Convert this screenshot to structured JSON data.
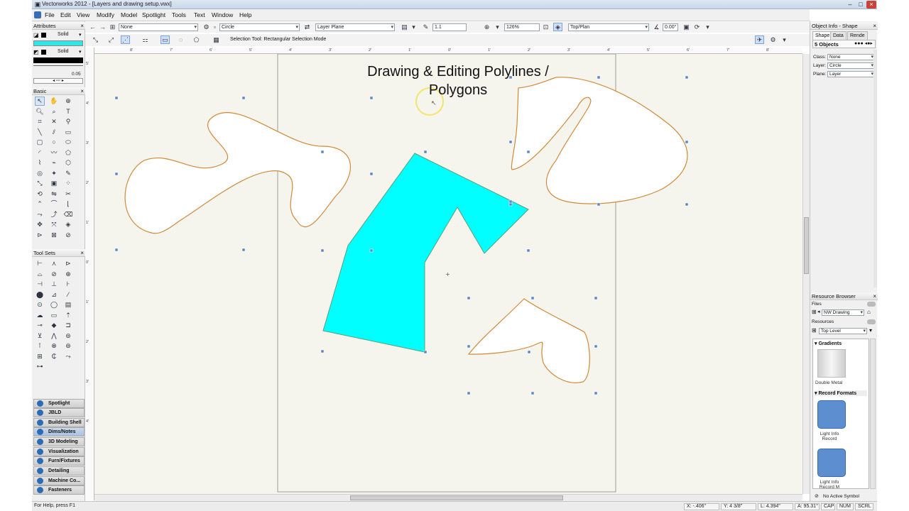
{
  "window": {
    "title": "Vectorworks 2012 - [Layers and drawing setup.vwx]"
  },
  "menu": [
    "File",
    "Edit",
    "View",
    "Modify",
    "Model",
    "Spotlight",
    "Tools",
    "Text",
    "Window",
    "Help"
  ],
  "view_bar": {
    "class_value": "None",
    "fill_value": "Circle",
    "layer_value": "Layer Plane",
    "pen_value": "1.1",
    "zoom_value": "126%",
    "view_value": "Top/Plan",
    "angle_value": "0.00°"
  },
  "mode_bar": {
    "mode_text": "Selection Tool: Rectangular Selection Mode"
  },
  "attributes": {
    "title": "Attributes",
    "fill_label": "Solid",
    "pen_label": "Solid",
    "fill_color": "#33e6e6",
    "line_value": "0.05"
  },
  "basic": {
    "title": "Basic"
  },
  "toolsets": {
    "title": "Tool Sets"
  },
  "workspace_bars": [
    "Spotlight",
    "JBLD",
    "Building Shell",
    "Dims/Notes",
    "3D Modeling",
    "Visualization",
    "Furn/Fixtures",
    "Detailing",
    "Machine Co...",
    "Fasteners"
  ],
  "rulers": {
    "top": [
      "8'",
      "7'",
      "6'",
      "5'",
      "4'",
      "3'",
      "2'",
      "1'",
      "0'",
      "1'",
      "2'",
      "3'",
      "4'",
      "5'",
      "6'",
      "7'",
      "8'"
    ],
    "left": [
      "5'",
      "4'",
      "3'",
      "2'",
      "1'",
      "0'",
      "1'",
      "2'",
      "3'",
      "4'"
    ]
  },
  "canvas": {
    "heading_line1": "Drawing & Editing Polylines /",
    "heading_line2": "Polygons",
    "colors": {
      "stroke": "#d08a3a",
      "poly_fill": "#00ffff",
      "shape_fill": "#ffffff",
      "handle": "#5a86c7",
      "highlight": "#f2e66a"
    }
  },
  "object_info": {
    "title": "Object Info - Shape",
    "tabs": [
      "Shape",
      "Data",
      "Rende"
    ],
    "count": "5 Objects",
    "class_label": "Class:",
    "class_value": "None",
    "layer_label": "Layer:",
    "layer_value": "Circle",
    "plane_label": "Plane:",
    "plane_value": "Layer"
  },
  "resource_browser": {
    "title": "Resource Browser",
    "files_label": "Files",
    "file_value": "NW Drawing",
    "resources_label": "Resources",
    "level_value": "Top Level",
    "group1": "Gradients",
    "item1": "Double Metal",
    "group2": "Record Formats",
    "item2_line1": "Light Info",
    "item2_line2": "Record",
    "item3_line1": "Light Info",
    "item3_line2": "Record M",
    "status": "No Active Symbol"
  },
  "status": {
    "help": "For Help, press F1",
    "x": "X: -.406\"",
    "y": "Y: 4 3/8\"",
    "l": "L: 4.394\"",
    "a": "A: 95.31°",
    "caps": "CAP",
    "num": "NUM",
    "scrl": "SCRL"
  }
}
